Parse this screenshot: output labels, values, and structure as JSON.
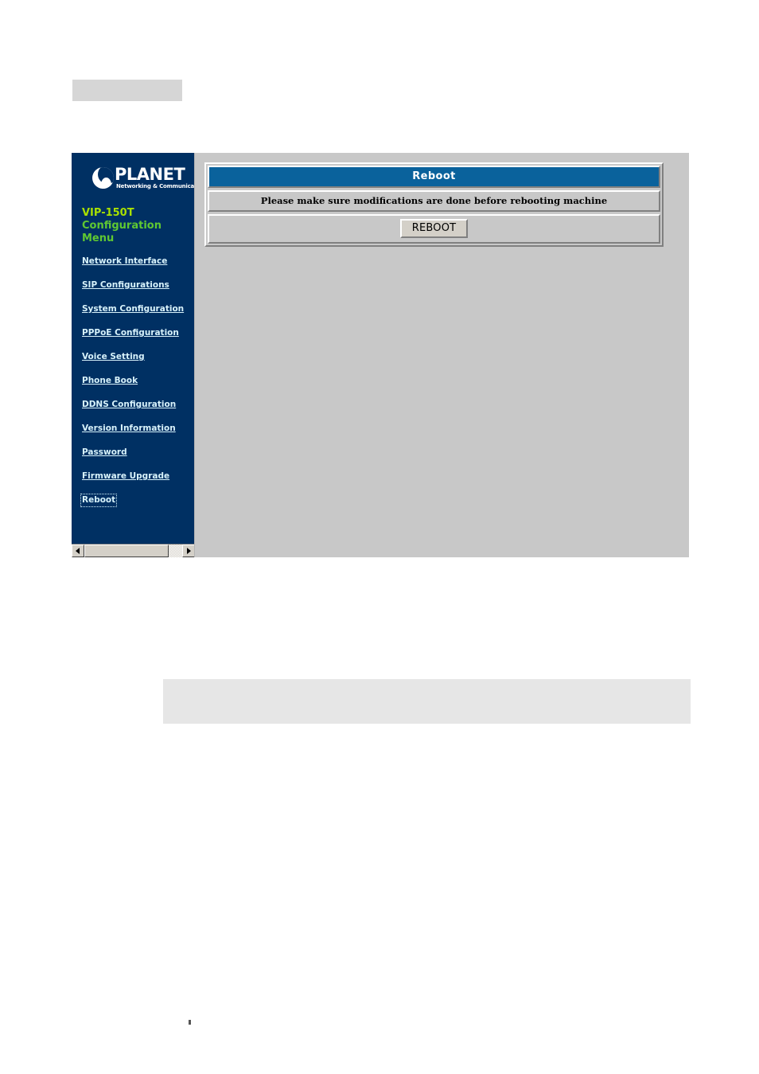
{
  "page": {
    "top_block_label": "",
    "bottom_block_label": ""
  },
  "device": {
    "brand": "PLANET",
    "brand_tagline": "Networking & Communication",
    "model": "VIP-150T",
    "menu_heading": "Configuration Menu"
  },
  "sidebar": {
    "items": [
      {
        "label": "Network Interface",
        "active": false
      },
      {
        "label": "SIP Configurations",
        "active": false
      },
      {
        "label": "System Configuration",
        "active": false
      },
      {
        "label": "PPPoE Configuration",
        "active": false
      },
      {
        "label": "Voice Setting",
        "active": false
      },
      {
        "label": "Phone Book",
        "active": false
      },
      {
        "label": "DDNS Configuration",
        "active": false
      },
      {
        "label": "Version Information",
        "active": false
      },
      {
        "label": "Password",
        "active": false
      },
      {
        "label": "Firmware Upgrade",
        "active": false
      },
      {
        "label": "Reboot",
        "active": true
      }
    ],
    "scrollbar": {
      "left_arrow": "◄",
      "right_arrow": "►"
    }
  },
  "main": {
    "panel_title": "Reboot",
    "notice": "Please make sure modifications are done before rebooting machine",
    "reboot_button": "REBOOT"
  },
  "colors": {
    "sidebar_navy": "#003063",
    "panel_header_blue": "#0a629c",
    "model_green": "#a8e000",
    "menu_heading_green": "#5fc832",
    "link_light": "#d8f2fb",
    "content_gray": "#c8c8c8"
  }
}
